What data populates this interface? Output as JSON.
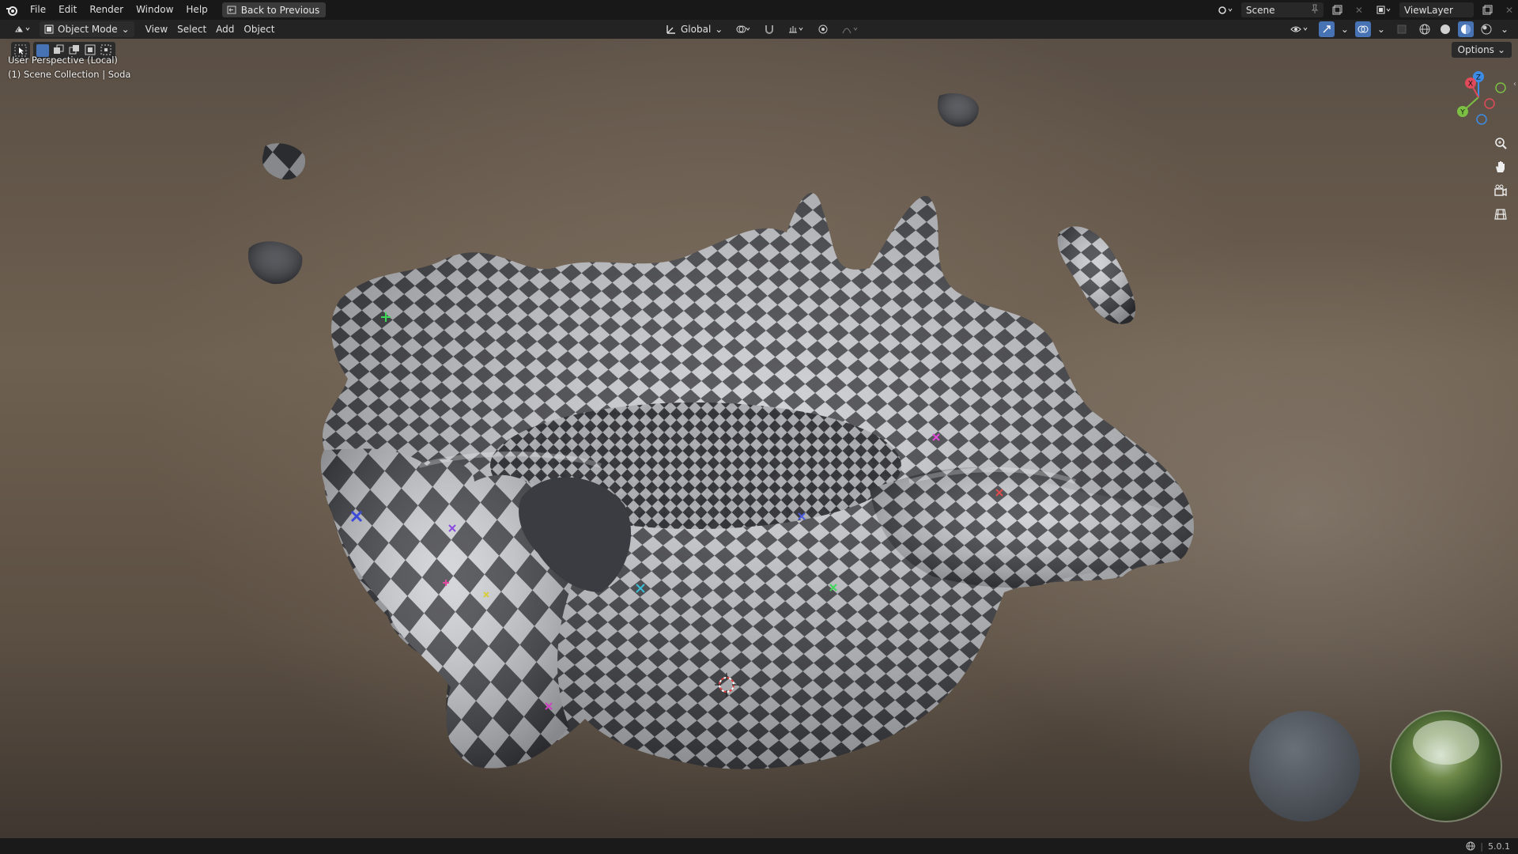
{
  "topbar": {
    "menus": [
      "File",
      "Edit",
      "Render",
      "Window",
      "Help"
    ],
    "back_button": "Back to Previous",
    "scene": "Scene",
    "view_layer": "ViewLayer"
  },
  "header": {
    "mode": "Object Mode",
    "menus": [
      "View",
      "Select",
      "Add",
      "Object"
    ],
    "transform_orientation": "Global",
    "options": "Options"
  },
  "viewport": {
    "perspective_label": "User Perspective (Local)",
    "collection_label": "(1) Scene Collection | Soda",
    "gizmo_axes": {
      "x": "X",
      "y": "Y",
      "z": "Z"
    }
  },
  "statusbar": {
    "version": "5.0.1"
  },
  "colors": {
    "axis_x": "#e04a5a",
    "axis_y": "#7bc043",
    "axis_z": "#3c8ce6",
    "active_blue": "#4772b3"
  }
}
